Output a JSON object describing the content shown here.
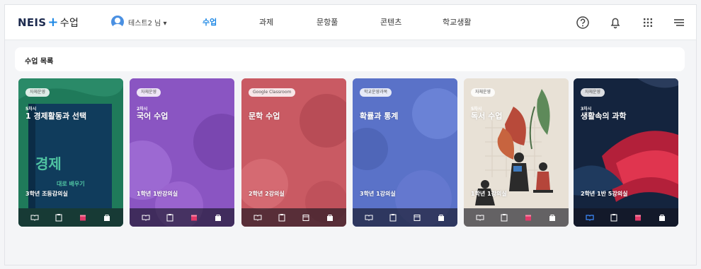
{
  "app": {
    "logo_main": "NEIS",
    "logo_plus": "+",
    "logo_sub": "수업"
  },
  "user": {
    "name": "테스트2 님 ▾"
  },
  "nav": [
    {
      "label": "수업",
      "active": true
    },
    {
      "label": "과제",
      "active": false
    },
    {
      "label": "문항풀",
      "active": false
    },
    {
      "label": "콘텐츠",
      "active": false
    },
    {
      "label": "학교생활",
      "active": false
    }
  ],
  "header_icons": [
    "help-icon",
    "bell-icon",
    "apps-grid-icon",
    "menu-icon"
  ],
  "section": {
    "title": "수업 목록"
  },
  "cards": [
    {
      "badge": "자체운영",
      "period": "5차시",
      "title": "1 경제활동과 선택",
      "room": "3학년 조등감의실",
      "color": "#1f7a5a",
      "cover_text_1": "경제",
      "cover_text_2": "대로 배우기"
    },
    {
      "badge": "자체운영",
      "period": "2차시",
      "title": "국어 수업",
      "room": "1학년 1반강의실",
      "color": "#8a55c2"
    },
    {
      "badge": "Google Classroom",
      "period": "",
      "title": "문학 수업",
      "room": "2학년 2강의실",
      "color": "#c95a63"
    },
    {
      "badge": "학교운영과목",
      "period": "",
      "title": "확률과 통계",
      "room": "3학년 1강의실",
      "color": "#5a72c8"
    },
    {
      "badge": "자체운영",
      "period": "5차시",
      "title": "독서 수업",
      "room": "1학년 1강의실",
      "color": "#e8e1d6"
    },
    {
      "badge": "자체운영",
      "period": "3차시",
      "title": "생활속의 과학",
      "room": "2학년 1반 5강의실",
      "color": "#14243e"
    }
  ],
  "card_footer_icons": [
    "book-icon",
    "clipboard-icon",
    "calendar-icon",
    "bag-icon"
  ],
  "colors": {
    "accent": "#1e88e5",
    "footer_active": "#e23a6a"
  }
}
